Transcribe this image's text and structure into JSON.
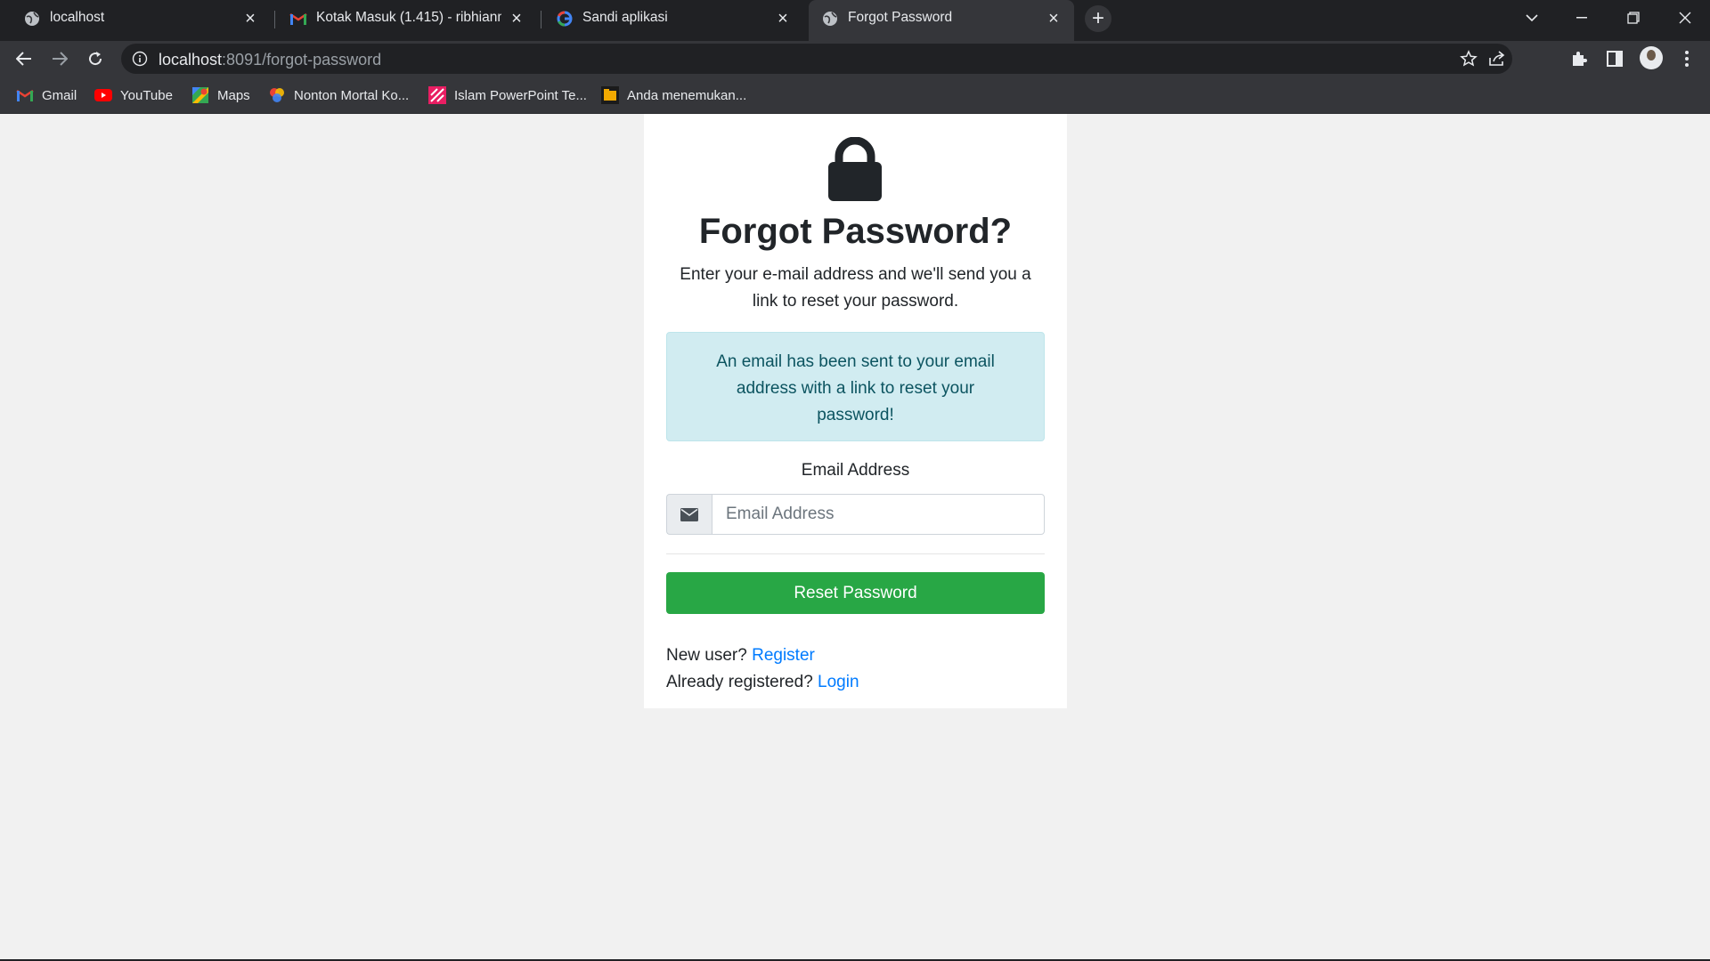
{
  "browser": {
    "tabs": [
      {
        "title": "localhost",
        "icon": "globe-icon",
        "active": false
      },
      {
        "title": "Kotak Masuk (1.415) - ribhianmh",
        "icon": "gmail-icon",
        "active": false
      },
      {
        "title": "Sandi aplikasi",
        "icon": "google-icon",
        "active": false
      },
      {
        "title": "Forgot Password",
        "icon": "globe-icon",
        "active": true
      }
    ],
    "address": {
      "host": "localhost",
      "path": ":8091/forgot-password"
    },
    "bookmarks": [
      {
        "label": "Gmail",
        "icon": "gmail-icon"
      },
      {
        "label": "YouTube",
        "icon": "youtube-icon"
      },
      {
        "label": "Maps",
        "icon": "maps-icon"
      },
      {
        "label": "Nonton Mortal Ko...",
        "icon": "film-icon"
      },
      {
        "label": "Islam PowerPoint Te...",
        "icon": "slides-icon"
      },
      {
        "label": "Anda menemukan...",
        "icon": "folder-icon"
      }
    ]
  },
  "page": {
    "title": "Forgot Password?",
    "subtitle": "Enter your e-mail address and we'll send you a link to reset your password.",
    "alert": "An email has been sent to your email address with a link to reset your password!",
    "email_label": "Email Address",
    "email_placeholder": "Email Address",
    "reset_button": "Reset Password",
    "new_user_text": "New user?",
    "register_link": "Register",
    "registered_text": "Already registered?",
    "login_link": "Login"
  },
  "colors": {
    "success_button": "#28a745",
    "alert_bg": "#d1ecf1",
    "alert_text": "#0c5460",
    "link": "#007bff"
  }
}
